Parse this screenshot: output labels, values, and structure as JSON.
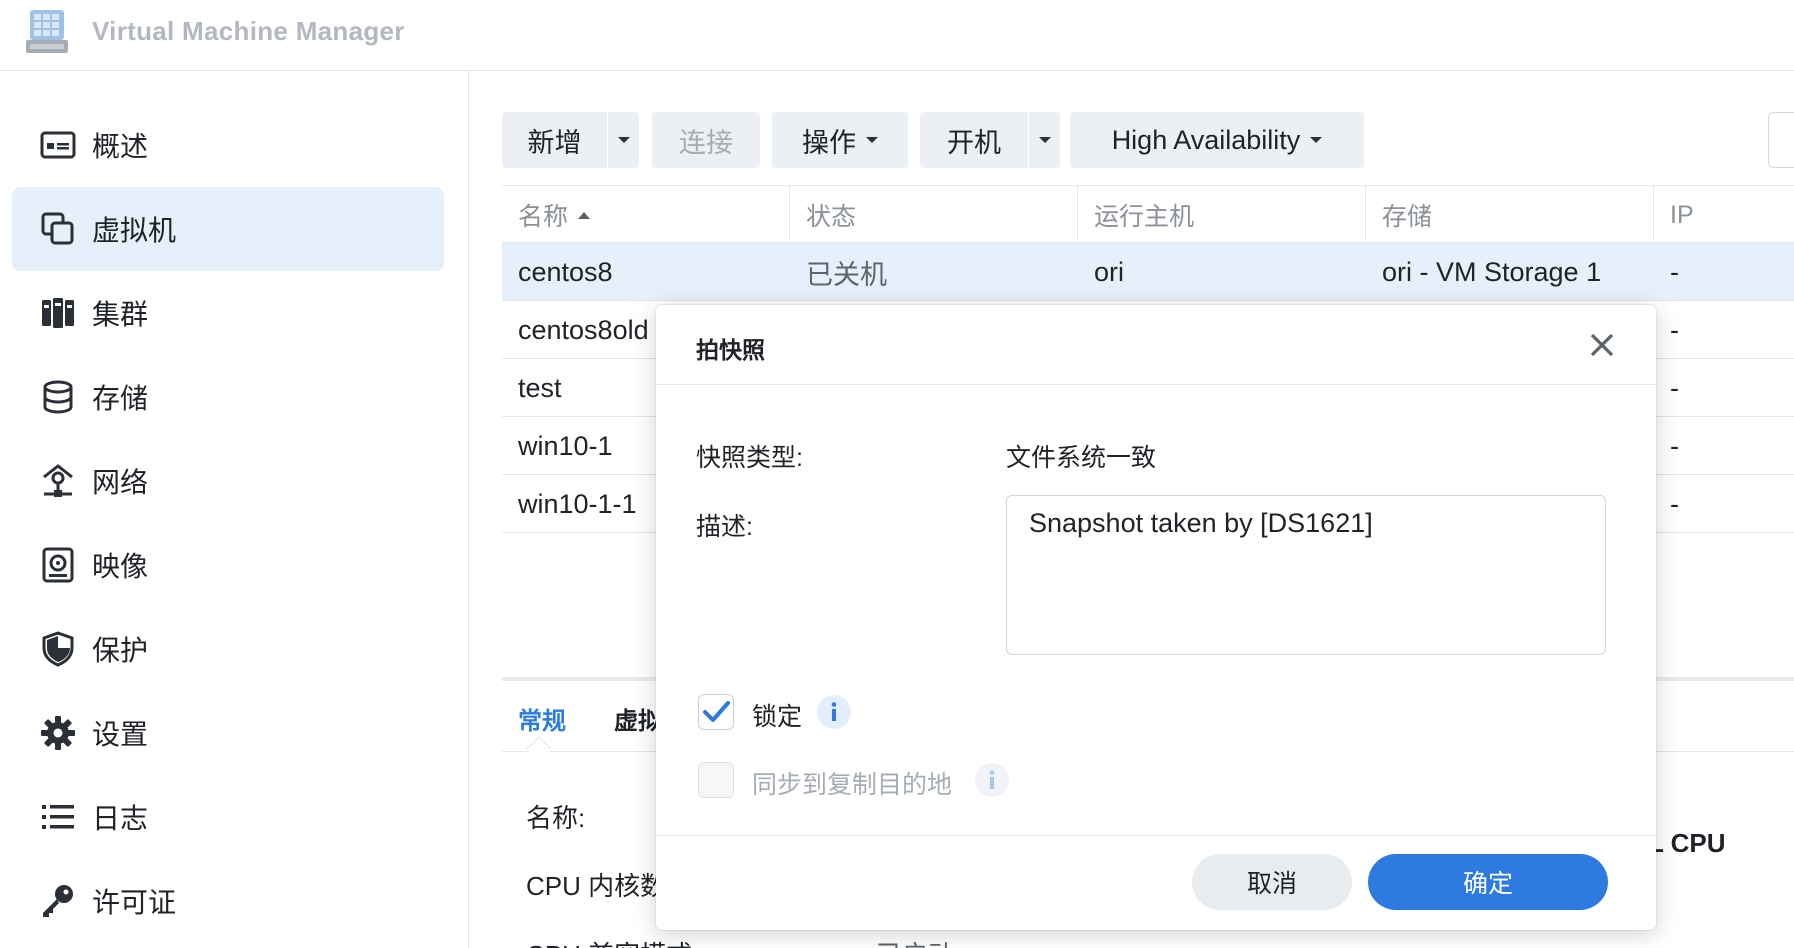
{
  "app": {
    "title": "Virtual Machine Manager"
  },
  "sidebar": {
    "items": [
      {
        "label": "概述",
        "icon": "overview-icon"
      },
      {
        "label": "虚拟机",
        "icon": "virtual-machine-icon"
      },
      {
        "label": "集群",
        "icon": "cluster-icon"
      },
      {
        "label": "存储",
        "icon": "storage-icon"
      },
      {
        "label": "网络",
        "icon": "network-icon"
      },
      {
        "label": "映像",
        "icon": "image-icon"
      },
      {
        "label": "保护",
        "icon": "shield-icon"
      },
      {
        "label": "设置",
        "icon": "gear-icon"
      },
      {
        "label": "日志",
        "icon": "list-icon"
      },
      {
        "label": "许可证",
        "icon": "key-icon"
      }
    ],
    "active_index": 1
  },
  "toolbar": {
    "add_label": "新增",
    "connect_label": "连接",
    "action_label": "操作",
    "power_on_label": "开机",
    "ha_label": "High Availability"
  },
  "grid": {
    "columns": [
      "名称",
      "状态",
      "运行主机",
      "存储",
      "IP"
    ],
    "rows": [
      {
        "name": "centos8",
        "status": "已关机",
        "host": "ori",
        "storage": "ori - VM Storage 1",
        "ip": "-"
      },
      {
        "name": "centos8old",
        "status": "",
        "host": "",
        "storage": "",
        "ip": "-"
      },
      {
        "name": "test",
        "status": "",
        "host": "",
        "storage": "",
        "ip": "-"
      },
      {
        "name": "win10-1",
        "status": "",
        "host": "",
        "storage": "",
        "ip": "-"
      },
      {
        "name": "win10-1-1",
        "status": "",
        "host": "",
        "storage": "",
        "ip": "-"
      }
    ]
  },
  "detail": {
    "tabs": [
      "常规",
      "虚拟"
    ],
    "labels": {
      "name": "名称:",
      "cpu_cores": "CPU 内核数",
      "cpu_compat": "CPU 兼容模式:",
      "cpu_compat_value": "已启动",
      "right_cpu": "L CPU"
    }
  },
  "modal": {
    "title": "拍快照",
    "type_label": "快照类型:",
    "type_value": "文件系统一致",
    "desc_label": "描述:",
    "desc_value": "Snapshot taken by [DS1621]",
    "lock_label": "锁定",
    "lock_checked": true,
    "sync_label": "同步到复制目的地",
    "sync_checked": false,
    "cancel_label": "取消",
    "ok_label": "确定"
  },
  "colors": {
    "accent": "#2d7ae0",
    "selected_row": "#e6f0fb",
    "muted_text": "#a6acb3"
  }
}
